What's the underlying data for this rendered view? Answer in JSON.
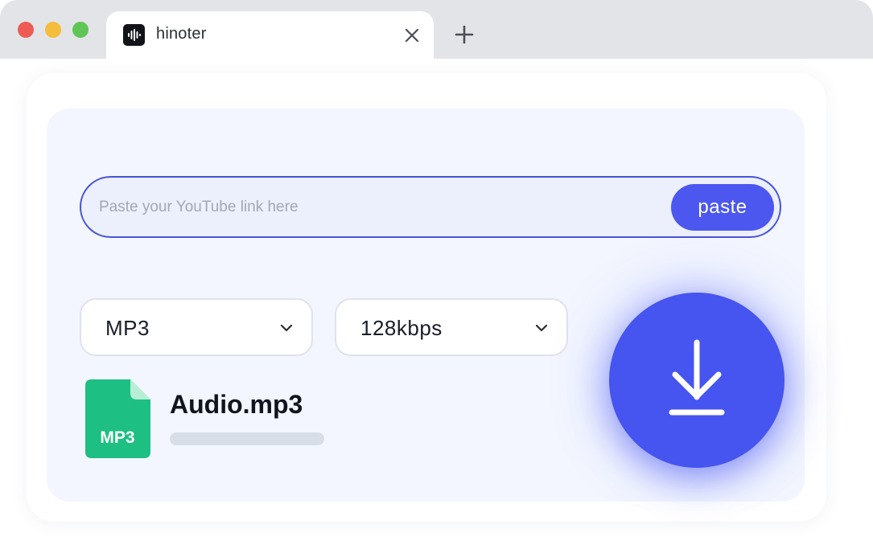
{
  "browser": {
    "tab": {
      "title": "hinoter",
      "favicon": "waveform-icon"
    },
    "close_icon": "close-icon",
    "new_tab_icon": "plus-icon"
  },
  "converter": {
    "url_input": {
      "value": "",
      "placeholder": "Paste your YouTube link here"
    },
    "paste_button": "paste",
    "format_select": {
      "selected": "MP3"
    },
    "bitrate_select": {
      "selected": "128kbps"
    },
    "file": {
      "icon_label": "MP3",
      "name": "Audio.mp3",
      "progress": 0
    },
    "download_icon": "download-arrow-icon"
  },
  "colors": {
    "accent": "#4c57f0",
    "file_icon_green": "#1dbf82",
    "card_background": "#f3f6fe"
  }
}
